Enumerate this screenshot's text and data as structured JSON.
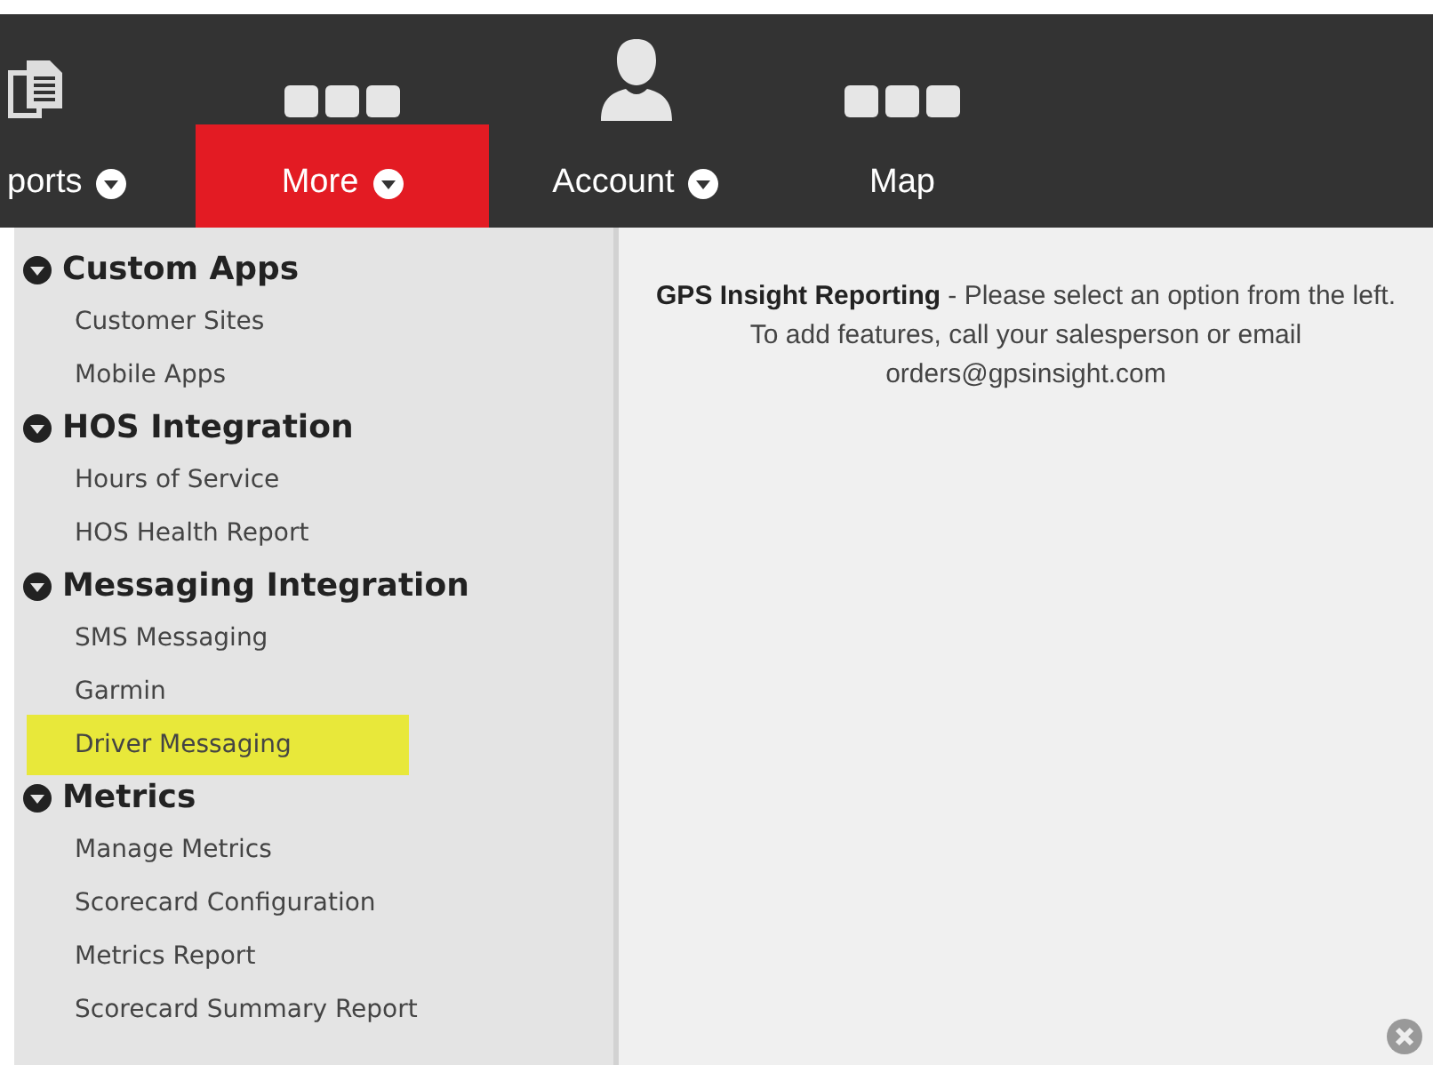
{
  "nav": [
    {
      "label": "ports",
      "caret": true,
      "selected": false
    },
    {
      "label": "More",
      "caret": true,
      "selected": true
    },
    {
      "label": "Account",
      "caret": true,
      "selected": false
    },
    {
      "label": "Map",
      "caret": false,
      "selected": false
    }
  ],
  "menu": [
    {
      "title": "Custom Apps",
      "items": [
        {
          "label": "Customer Sites",
          "selected": false
        },
        {
          "label": "Mobile Apps",
          "selected": false
        }
      ]
    },
    {
      "title": "HOS Integration",
      "items": [
        {
          "label": "Hours of Service",
          "selected": false
        },
        {
          "label": "HOS Health Report",
          "selected": false
        }
      ]
    },
    {
      "title": "Messaging Integration",
      "items": [
        {
          "label": "SMS Messaging",
          "selected": false
        },
        {
          "label": "Garmin",
          "selected": false
        },
        {
          "label": "Driver Messaging",
          "selected": true
        }
      ]
    },
    {
      "title": "Metrics",
      "items": [
        {
          "label": "Manage Metrics",
          "selected": false
        },
        {
          "label": "Scorecard Configuration",
          "selected": false
        },
        {
          "label": "Metrics Report",
          "selected": false
        },
        {
          "label": "Scorecard Summary Report",
          "selected": false
        }
      ]
    }
  ],
  "message": "**GPS Insight Reporting** - Please select an option from the left. To add features, call your salesperson or email orders@gpsinsight.com"
}
